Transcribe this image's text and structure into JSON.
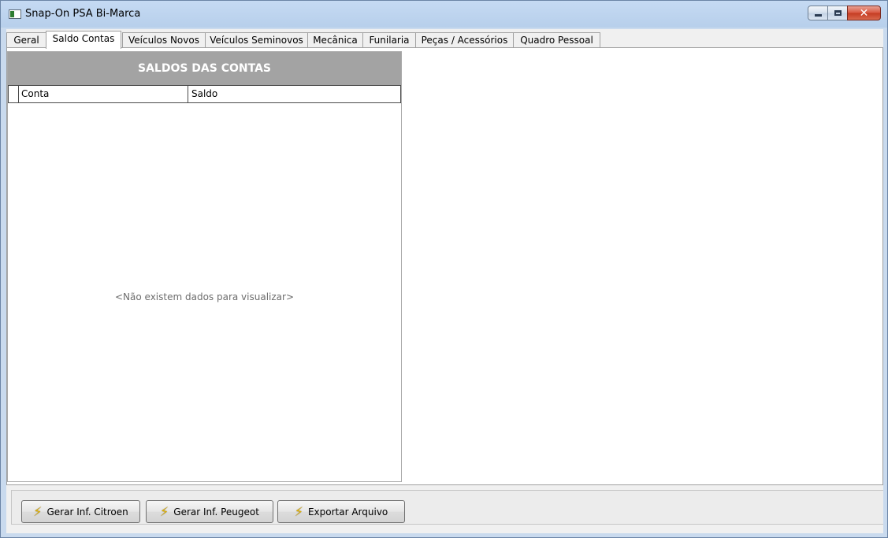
{
  "window": {
    "title": "Snap-On PSA Bi-Marca"
  },
  "tabs": [
    {
      "label": "Geral"
    },
    {
      "label": "Saldo Contas",
      "active": true
    },
    {
      "label": "Veículos Novos"
    },
    {
      "label": "Veículos Seminovos"
    },
    {
      "label": "Mecânica"
    },
    {
      "label": "Funilaria"
    },
    {
      "label": "Peças / Acessórios"
    },
    {
      "label": "Quadro Pessoal"
    }
  ],
  "grid": {
    "title": "SALDOS DAS CONTAS",
    "columns": [
      "Conta",
      "Saldo"
    ],
    "empty_text": "<Não existem dados para visualizar>"
  },
  "buttons": {
    "citroen": "Gerar Inf. Citroen",
    "peugeot": "Gerar Inf. Peugeot",
    "export": "Exportar Arquivo"
  },
  "icons": {
    "app": "app-window-icon",
    "action": "lightning-bolt-icon"
  }
}
